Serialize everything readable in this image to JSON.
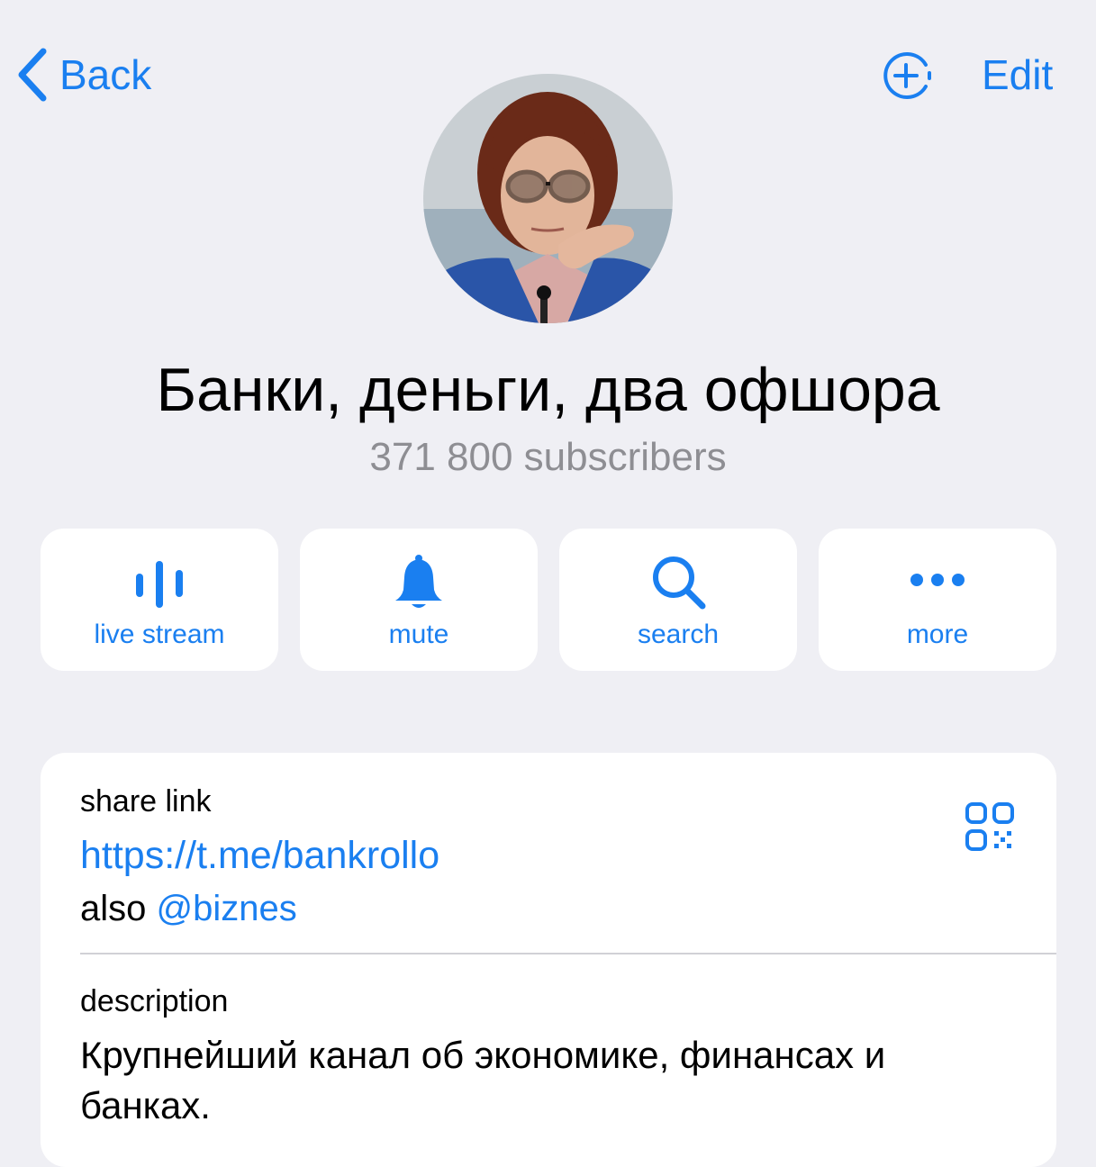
{
  "nav": {
    "back_label": "Back",
    "edit_label": "Edit"
  },
  "icons": {
    "back": "chevron-left-icon",
    "add": "circle-plus-icon",
    "live_stream": "voice-wave-icon",
    "mute": "bell-icon",
    "search": "magnifier-icon",
    "more": "ellipsis-icon",
    "qr": "qr-code-icon"
  },
  "channel": {
    "title": "Банки, деньги, два офшора",
    "subscribers": "371 800 subscribers"
  },
  "actions": [
    {
      "label": "live stream"
    },
    {
      "label": "mute"
    },
    {
      "label": "search"
    },
    {
      "label": "more"
    }
  ],
  "info": {
    "share_label": "share link",
    "link": "https://t.me/bankrollo",
    "also_prefix": "also ",
    "also_handle": "@biznes",
    "description_label": "description",
    "description": "Крупнейший канал об экономике, финансах и банках."
  },
  "colors": {
    "accent": "#1a7ff0",
    "background": "#efeff4",
    "secondary_text": "#8e8e93"
  }
}
